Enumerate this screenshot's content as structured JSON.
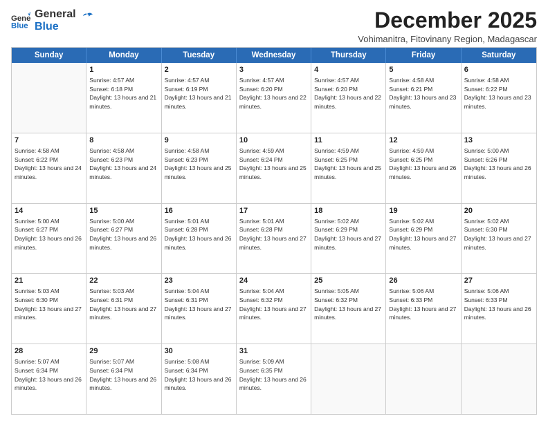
{
  "logo": {
    "line1": "General",
    "line2": "Blue"
  },
  "title": "December 2025",
  "subtitle": "Vohimanitra, Fitovinany Region, Madagascar",
  "header_days": [
    "Sunday",
    "Monday",
    "Tuesday",
    "Wednesday",
    "Thursday",
    "Friday",
    "Saturday"
  ],
  "rows": [
    [
      {
        "day": "",
        "sunrise": "",
        "sunset": "",
        "daylight": ""
      },
      {
        "day": "1",
        "sunrise": "Sunrise: 4:57 AM",
        "sunset": "Sunset: 6:18 PM",
        "daylight": "Daylight: 13 hours and 21 minutes."
      },
      {
        "day": "2",
        "sunrise": "Sunrise: 4:57 AM",
        "sunset": "Sunset: 6:19 PM",
        "daylight": "Daylight: 13 hours and 21 minutes."
      },
      {
        "day": "3",
        "sunrise": "Sunrise: 4:57 AM",
        "sunset": "Sunset: 6:20 PM",
        "daylight": "Daylight: 13 hours and 22 minutes."
      },
      {
        "day": "4",
        "sunrise": "Sunrise: 4:57 AM",
        "sunset": "Sunset: 6:20 PM",
        "daylight": "Daylight: 13 hours and 22 minutes."
      },
      {
        "day": "5",
        "sunrise": "Sunrise: 4:58 AM",
        "sunset": "Sunset: 6:21 PM",
        "daylight": "Daylight: 13 hours and 23 minutes."
      },
      {
        "day": "6",
        "sunrise": "Sunrise: 4:58 AM",
        "sunset": "Sunset: 6:22 PM",
        "daylight": "Daylight: 13 hours and 23 minutes."
      }
    ],
    [
      {
        "day": "7",
        "sunrise": "Sunrise: 4:58 AM",
        "sunset": "Sunset: 6:22 PM",
        "daylight": "Daylight: 13 hours and 24 minutes."
      },
      {
        "day": "8",
        "sunrise": "Sunrise: 4:58 AM",
        "sunset": "Sunset: 6:23 PM",
        "daylight": "Daylight: 13 hours and 24 minutes."
      },
      {
        "day": "9",
        "sunrise": "Sunrise: 4:58 AM",
        "sunset": "Sunset: 6:23 PM",
        "daylight": "Daylight: 13 hours and 25 minutes."
      },
      {
        "day": "10",
        "sunrise": "Sunrise: 4:59 AM",
        "sunset": "Sunset: 6:24 PM",
        "daylight": "Daylight: 13 hours and 25 minutes."
      },
      {
        "day": "11",
        "sunrise": "Sunrise: 4:59 AM",
        "sunset": "Sunset: 6:25 PM",
        "daylight": "Daylight: 13 hours and 25 minutes."
      },
      {
        "day": "12",
        "sunrise": "Sunrise: 4:59 AM",
        "sunset": "Sunset: 6:25 PM",
        "daylight": "Daylight: 13 hours and 26 minutes."
      },
      {
        "day": "13",
        "sunrise": "Sunrise: 5:00 AM",
        "sunset": "Sunset: 6:26 PM",
        "daylight": "Daylight: 13 hours and 26 minutes."
      }
    ],
    [
      {
        "day": "14",
        "sunrise": "Sunrise: 5:00 AM",
        "sunset": "Sunset: 6:27 PM",
        "daylight": "Daylight: 13 hours and 26 minutes."
      },
      {
        "day": "15",
        "sunrise": "Sunrise: 5:00 AM",
        "sunset": "Sunset: 6:27 PM",
        "daylight": "Daylight: 13 hours and 26 minutes."
      },
      {
        "day": "16",
        "sunrise": "Sunrise: 5:01 AM",
        "sunset": "Sunset: 6:28 PM",
        "daylight": "Daylight: 13 hours and 26 minutes."
      },
      {
        "day": "17",
        "sunrise": "Sunrise: 5:01 AM",
        "sunset": "Sunset: 6:28 PM",
        "daylight": "Daylight: 13 hours and 27 minutes."
      },
      {
        "day": "18",
        "sunrise": "Sunrise: 5:02 AM",
        "sunset": "Sunset: 6:29 PM",
        "daylight": "Daylight: 13 hours and 27 minutes."
      },
      {
        "day": "19",
        "sunrise": "Sunrise: 5:02 AM",
        "sunset": "Sunset: 6:29 PM",
        "daylight": "Daylight: 13 hours and 27 minutes."
      },
      {
        "day": "20",
        "sunrise": "Sunrise: 5:02 AM",
        "sunset": "Sunset: 6:30 PM",
        "daylight": "Daylight: 13 hours and 27 minutes."
      }
    ],
    [
      {
        "day": "21",
        "sunrise": "Sunrise: 5:03 AM",
        "sunset": "Sunset: 6:30 PM",
        "daylight": "Daylight: 13 hours and 27 minutes."
      },
      {
        "day": "22",
        "sunrise": "Sunrise: 5:03 AM",
        "sunset": "Sunset: 6:31 PM",
        "daylight": "Daylight: 13 hours and 27 minutes."
      },
      {
        "day": "23",
        "sunrise": "Sunrise: 5:04 AM",
        "sunset": "Sunset: 6:31 PM",
        "daylight": "Daylight: 13 hours and 27 minutes."
      },
      {
        "day": "24",
        "sunrise": "Sunrise: 5:04 AM",
        "sunset": "Sunset: 6:32 PM",
        "daylight": "Daylight: 13 hours and 27 minutes."
      },
      {
        "day": "25",
        "sunrise": "Sunrise: 5:05 AM",
        "sunset": "Sunset: 6:32 PM",
        "daylight": "Daylight: 13 hours and 27 minutes."
      },
      {
        "day": "26",
        "sunrise": "Sunrise: 5:06 AM",
        "sunset": "Sunset: 6:33 PM",
        "daylight": "Daylight: 13 hours and 27 minutes."
      },
      {
        "day": "27",
        "sunrise": "Sunrise: 5:06 AM",
        "sunset": "Sunset: 6:33 PM",
        "daylight": "Daylight: 13 hours and 26 minutes."
      }
    ],
    [
      {
        "day": "28",
        "sunrise": "Sunrise: 5:07 AM",
        "sunset": "Sunset: 6:34 PM",
        "daylight": "Daylight: 13 hours and 26 minutes."
      },
      {
        "day": "29",
        "sunrise": "Sunrise: 5:07 AM",
        "sunset": "Sunset: 6:34 PM",
        "daylight": "Daylight: 13 hours and 26 minutes."
      },
      {
        "day": "30",
        "sunrise": "Sunrise: 5:08 AM",
        "sunset": "Sunset: 6:34 PM",
        "daylight": "Daylight: 13 hours and 26 minutes."
      },
      {
        "day": "31",
        "sunrise": "Sunrise: 5:09 AM",
        "sunset": "Sunset: 6:35 PM",
        "daylight": "Daylight: 13 hours and 26 minutes."
      },
      {
        "day": "",
        "sunrise": "",
        "sunset": "",
        "daylight": ""
      },
      {
        "day": "",
        "sunrise": "",
        "sunset": "",
        "daylight": ""
      },
      {
        "day": "",
        "sunrise": "",
        "sunset": "",
        "daylight": ""
      }
    ]
  ]
}
